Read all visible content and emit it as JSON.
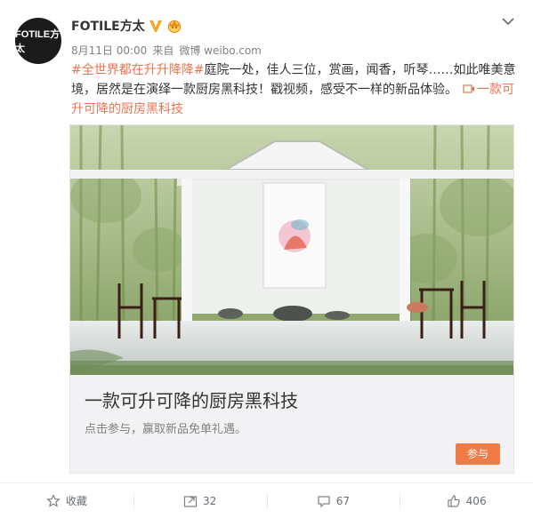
{
  "post": {
    "avatar_text": "FOTILE方太",
    "username": "FOTILE方太",
    "meta": {
      "date": "8月11日 00:00",
      "via": "来自",
      "source": "微博 weibo.com"
    },
    "text": {
      "hashtag": "#全世界都在升升降降#",
      "body": "庭院一处，佳人三位，赏画，闻香，听琴……如此唯美意境，居然是在演绎一款厨房黑科技！戳视频，感受不一样的新品体验。",
      "link_label": "一款可升可降的厨房黑科技"
    }
  },
  "media": {
    "title": "一款可升可降的厨房黑科技",
    "subtitle": "点击参与，赢取新品免单礼遇。",
    "button_label": "参与"
  },
  "footer": {
    "favorite_label": "收藏",
    "repost_count": "32",
    "comment_count": "67",
    "like_count": "406"
  },
  "colors": {
    "accent": "#eb7350",
    "button": "#f07b44",
    "verified": "#f5a623"
  }
}
